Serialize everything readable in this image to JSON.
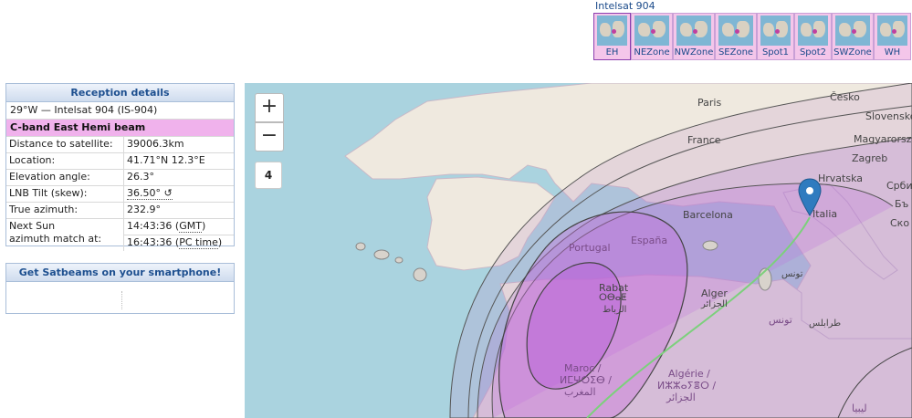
{
  "beam_selector": {
    "title": "Intelsat 904",
    "beams": [
      {
        "label": "EH",
        "active": true
      },
      {
        "label": "NEZone",
        "active": false
      },
      {
        "label": "NWZone",
        "active": false
      },
      {
        "label": "SEZone",
        "active": false
      },
      {
        "label": "Spot1",
        "active": false
      },
      {
        "label": "Spot2",
        "active": false
      },
      {
        "label": "SWZone",
        "active": false
      },
      {
        "label": "WH",
        "active": false
      }
    ]
  },
  "reception": {
    "heading": "Reception details",
    "satellite": "29°W — Intelsat 904 (IS-904)",
    "beam": "C-band East Hemi beam",
    "rows": [
      {
        "label": "Distance to satellite:",
        "value": "39006.3km"
      },
      {
        "label": "Location:",
        "value": "41.71°N 12.3°E"
      },
      {
        "label": "Elevation angle:",
        "value": "26.3°"
      },
      {
        "label": "LNB Tilt (skew):",
        "value": "36.50° ↺"
      },
      {
        "label": "True azimuth:",
        "value": "232.9°"
      }
    ],
    "sun": {
      "label_line1": "Next Sun",
      "label_line2": "azimuth match at:",
      "time1": "14:43:36",
      "zone1": "GMT",
      "time2": "16:43:36",
      "zone2": "PC time"
    }
  },
  "smartphone": {
    "heading": "Get Satbeams on your smartphone!"
  },
  "map": {
    "zoom_in": "+",
    "zoom_out": "−",
    "zoom_level": "4",
    "labels": {
      "paris": "Paris",
      "france": "France",
      "cesko": "Česko",
      "slovensko": "Slovensko",
      "magyarorszag": "Magyarország",
      "zagreb": "Zagreb",
      "hrvatska": "Hrvatska",
      "srbija": "Срби",
      "italia": "Italia",
      "barcelona": "Barcelona",
      "espana": "España",
      "portugal": "Portugal",
      "rabat": "Rabat",
      "rabat_tif": "ⵔⴱⴰⵟ",
      "rabat_ar": "الرباط",
      "alger": "Alger",
      "alger_ar": "الجزائر",
      "tunis_ar": "تونس",
      "tounes": "تونس",
      "tarabulus": "طرابلس",
      "maroc": "Maroc /",
      "maroc_tif": "ⵍⵎⵖⵔⵉⴱ /",
      "maroc_ar": "المغرب",
      "algerie": "Algérie /",
      "algerie_tif": "ⵍⵣⵣⴰⵢⴻⵔ /",
      "algerie_ar": "الجزائر",
      "libya": "ليبيا",
      "bg": "Бъ",
      "sko": "Ско"
    }
  }
}
